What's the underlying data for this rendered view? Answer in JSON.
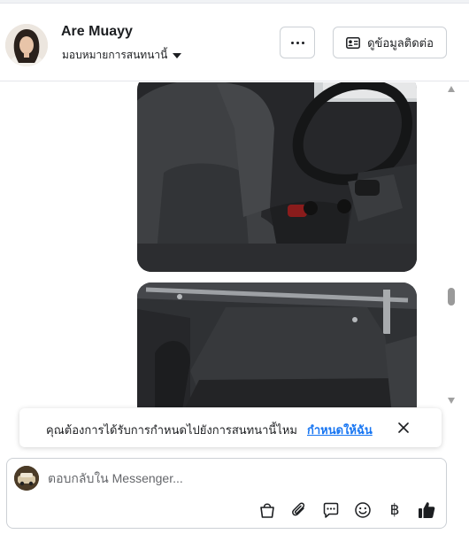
{
  "header": {
    "contact_name": "Are Muayy",
    "assign_label": "มอบหมายการสนทนานี้",
    "more_icon": "more-options-icon",
    "contact_info_label": "ดูข้อมูลติดต่อ",
    "contact_info_icon": "contact-card-icon"
  },
  "messages": {
    "photos": [
      {
        "subject": "car-interior-seats"
      },
      {
        "subject": "car-trunk-open"
      }
    ]
  },
  "banner": {
    "text": "คุณต้องการได้รับการกำหนดไปยังการสนทนานี้ไหม",
    "link": "กำหนดให้ฉัน",
    "close_icon": "close-icon"
  },
  "composer": {
    "placeholder": "ตอบกลับใน Messenger...",
    "tools": [
      "shop-bag-icon",
      "attachment-icon",
      "saved-reply-icon",
      "emoji-icon",
      "baht-payment-icon",
      "thumbs-up-icon"
    ],
    "baht_symbol": "฿"
  },
  "colors": {
    "link": "#1876f2",
    "border": "#ccd0d5",
    "text": "#1c1e21",
    "muted": "#65676b"
  }
}
